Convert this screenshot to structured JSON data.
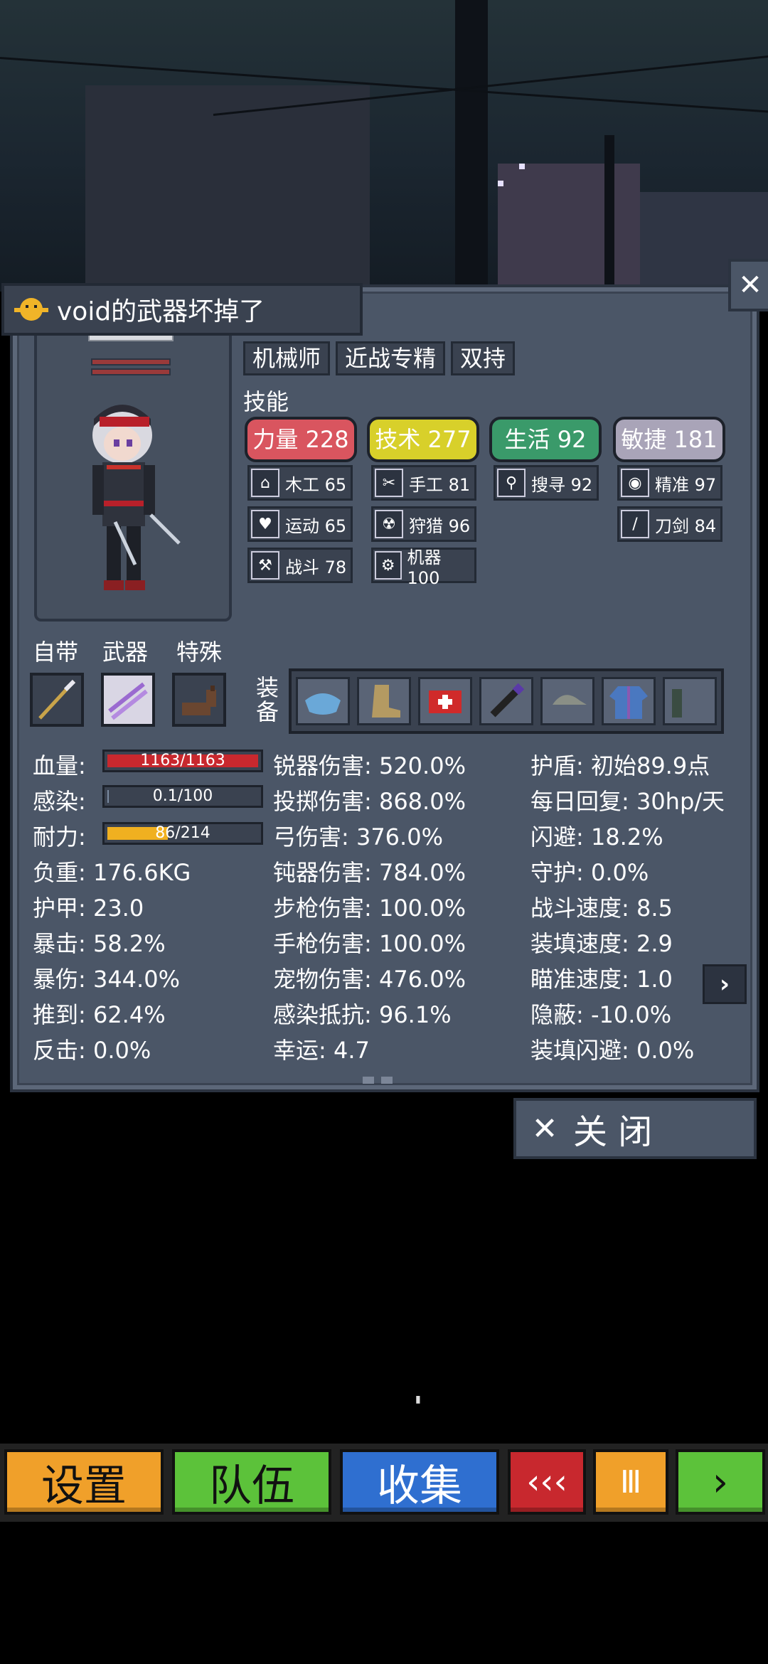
{
  "notification": {
    "text": "void的武器坏掉了"
  },
  "close_x": "✕",
  "traits": [
    "机械师",
    "近战专精",
    "双持"
  ],
  "skills_label": "技能",
  "attributes": [
    {
      "label": "力量 228",
      "color": "#d9555f"
    },
    {
      "label": "技术 277",
      "color": "#d8d02a"
    },
    {
      "label": "生活 92",
      "color": "#3a9a6a"
    },
    {
      "label": "敏捷 181",
      "color": "#a9a4b8"
    }
  ],
  "skills": [
    {
      "icon": "house-icon",
      "glyph": "⌂",
      "label": "木工 65"
    },
    {
      "icon": "scissors-icon",
      "glyph": "✂",
      "label": "手工 81"
    },
    {
      "icon": "magnifier-icon",
      "glyph": "⚲",
      "label": "搜寻 92"
    },
    {
      "icon": "eye-icon",
      "glyph": "◉",
      "label": "精准 97"
    },
    {
      "icon": "heart-icon",
      "glyph": "♥",
      "label": "运动 65"
    },
    {
      "icon": "radiation-icon",
      "glyph": "☢",
      "label": "狩猎 96"
    },
    {
      "icon": "blade-icon",
      "glyph": "/",
      "label": "刀剑 84"
    },
    {
      "icon": "hammer-icon",
      "glyph": "⚒",
      "label": "战斗 78"
    },
    {
      "icon": "gear-icon",
      "glyph": "⚙",
      "label": "机器 100"
    }
  ],
  "slots": {
    "builtin": "自带",
    "weapon": "武器",
    "special": "特殊",
    "equip": "装备"
  },
  "left_stats": {
    "hp_label": "血量:",
    "hp_value": "1163/1163",
    "hp_fraction": 1.0,
    "infection_label": "感染:",
    "infection_value": "0.1/100",
    "infection_fraction": 0.001,
    "stamina_label": "耐力:",
    "stamina_value": "86/214",
    "stamina_fraction": 0.4,
    "weight": "负重: 176.6KG",
    "armor": "护甲: 23.0",
    "crit": "暴击: 58.2%",
    "crit_damage": "暴伤: 344.0%",
    "knockdown": "推到: 62.4%",
    "counter": "反击: 0.0%"
  },
  "mid_stats": [
    "锐器伤害: 520.0%",
    "投掷伤害: 868.0%",
    "弓伤害: 376.0%",
    "钝器伤害: 784.0%",
    "步枪伤害: 100.0%",
    "手枪伤害: 100.0%",
    "宠物伤害: 476.0%",
    "感染抵抗: 96.1%",
    "幸运: 4.7"
  ],
  "right_stats": [
    "护盾: 初始89.9点",
    "每日回复: 30hp/天",
    "闪避: 18.2%",
    "守护: 0.0%",
    "战斗速度: 8.5",
    "装填速度: 2.9",
    "瞄准速度: 1.0",
    "隐蔽: -10.0%",
    "装填闪避: 0.0%"
  ],
  "next_arrow": "›",
  "close_button": {
    "icon": "✕",
    "label": "关 闭"
  },
  "bottom_bar": [
    {
      "label": "设置",
      "color": "#f0a02a"
    },
    {
      "label": "队伍",
      "color": "#5cc23a"
    },
    {
      "label": "收集",
      "color": "#2f6fd0"
    },
    {
      "label": "‹‹‹",
      "color": "#c8282e"
    },
    {
      "label": "Ⅲ",
      "color": "#f0a02a"
    },
    {
      "label": "›",
      "color": "#5cc23a"
    }
  ]
}
